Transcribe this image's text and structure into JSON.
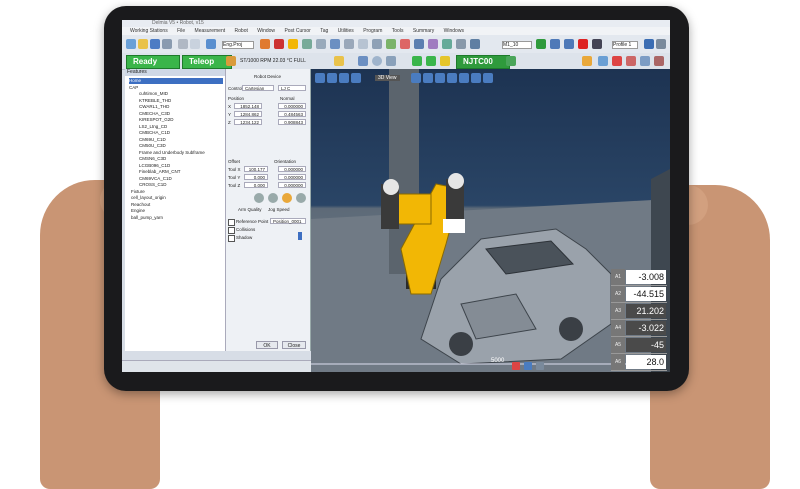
{
  "app": {
    "title": "Delmia V5 • Robot, v15",
    "menu": [
      "Working Stations",
      "File",
      "Measurement",
      "Robot",
      "Window",
      "Post Cursor",
      "Tag",
      "Utilities",
      "Program",
      "Tools",
      "Summary",
      "Windows"
    ],
    "status_ready": "Ready",
    "status_teleop": "Teleop",
    "toolbar_program": "NJTC00",
    "toolbar_target": "M1_10",
    "toolbar_profile": "Profile 1",
    "toolbar_speed": "ST/1000 RPM  22.03 °C  FULL",
    "toolbar_views": "Eng.Proj"
  },
  "tree": {
    "header": "Features",
    "root": "Home",
    "items": [
      {
        "label": "Home",
        "selected": true
      },
      {
        "label": "CAP",
        "selected": false
      },
      {
        "label": "cuhtimon_MID",
        "selected": false
      },
      {
        "label": "KTREBLE_THD",
        "selected": false
      },
      {
        "label": "CWARL1_THD",
        "selected": false
      },
      {
        "label": "CMECHA_C3D",
        "selected": false
      },
      {
        "label": "KIRESPOT_G2D",
        "selected": false
      },
      {
        "label": "LS2_Ltng_CD",
        "selected": false
      },
      {
        "label": "CMBCHA_C1D",
        "selected": false
      },
      {
        "label": "CM69U_C1D",
        "selected": false
      },
      {
        "label": "CM50U_C3D",
        "selected": false
      },
      {
        "label": "Frame and Underbody Subframe",
        "selected": false
      },
      {
        "label": "CMSN6_C3D",
        "selected": false
      },
      {
        "label": "LCGB096_C1D",
        "selected": false
      },
      {
        "label": "Fineblab_ARM_CNT",
        "selected": false
      },
      {
        "label": "CM69VCA_C1D",
        "selected": false
      },
      {
        "label": "CROSS_C1D",
        "selected": false
      },
      {
        "label": "Fixture",
        "selected": false
      },
      {
        "label": "cell_layout_origin",
        "selected": false
      },
      {
        "label": "Reachout",
        "selected": false
      },
      {
        "label": "Engine",
        "selected": false
      },
      {
        "label": "ball_pump_yarn",
        "selected": false
      }
    ]
  },
  "dialog": {
    "title": "Robot Device",
    "mode_label": "Control",
    "mode_value": "Cartesian",
    "frame_value": "LJ C",
    "position_label": "Position",
    "normal_label": "Normal",
    "rows": [
      {
        "axis": "X",
        "pos": "1852.148",
        "norm": "0.000000"
      },
      {
        "axis": "Y",
        "pos": "1284.862",
        "norm": "0.484563"
      },
      {
        "axis": "Z",
        "pos": "1234.122",
        "norm": "0.908843"
      }
    ],
    "offset_label": "Offset",
    "orientation_label": "Orientation",
    "offset_rows": [
      {
        "axis": "Tool X",
        "pos": "100.177",
        "norm": "0.000000"
      },
      {
        "axis": "Tool Y",
        "pos": "0.000",
        "norm": "0.000000"
      },
      {
        "axis": "Tool Z",
        "pos": "0.000",
        "norm": "0.000000"
      }
    ],
    "speed_label": "Jog Speed",
    "reach_label": "Arm Quality",
    "check1": "Reference Point",
    "check1_value": "Position_0001",
    "check2": "Collisions",
    "check3": "Shadow",
    "ok": "OK",
    "close": "Close"
  },
  "viewport": {
    "view_label": "3D View",
    "scale_label": "5000",
    "readout": [
      {
        "axis": "A1",
        "value": "-3.008"
      },
      {
        "axis": "A2",
        "value": "-44.515"
      },
      {
        "axis": "A3",
        "value": "21.202"
      },
      {
        "axis": "A4",
        "value": "-3.022"
      },
      {
        "axis": "A5",
        "value": "-45"
      },
      {
        "axis": "A6",
        "value": "28.0"
      }
    ]
  },
  "colors": {
    "status_green": "#3ab54a",
    "tree_selection": "#3d6fc2",
    "robot_yellow": "#f2b705",
    "sky_top": "#1d3352",
    "tablet_bezel": "#1a1a1c"
  }
}
